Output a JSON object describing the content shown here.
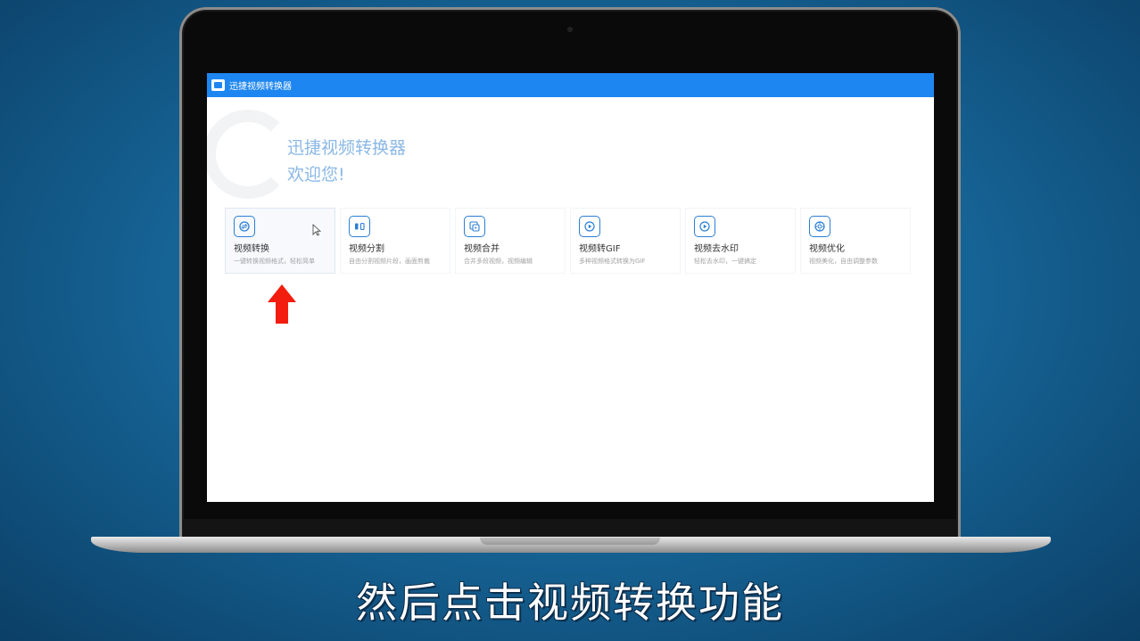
{
  "app": {
    "title": "迅捷视频转换器"
  },
  "hero": {
    "title": "迅捷视频转换器",
    "subtitle": "欢迎您!"
  },
  "cards": [
    {
      "title": "视频转换",
      "desc": "一键转换视频格式，轻松简单",
      "icon": "convert-icon",
      "active": true
    },
    {
      "title": "视频分割",
      "desc": "自由分割视频片段，画面剪裁",
      "icon": "split-icon"
    },
    {
      "title": "视频合并",
      "desc": "合并多段视频，视频编辑",
      "icon": "merge-icon"
    },
    {
      "title": "视频转GIF",
      "desc": "多种视频格式转换为GIF",
      "icon": "gif-icon"
    },
    {
      "title": "视频去水印",
      "desc": "轻松去水印，一键搞定",
      "icon": "watermark-icon"
    },
    {
      "title": "视频优化",
      "desc": "视频美化，自由调整参数",
      "icon": "optimize-icon"
    }
  ],
  "caption": "然后点击视频转换功能",
  "colors": {
    "accent": "#1e86f0",
    "icon_blue": "#2b7fd6",
    "hero_text": "#8ab8e6",
    "arrow_red": "#f21d0f"
  }
}
